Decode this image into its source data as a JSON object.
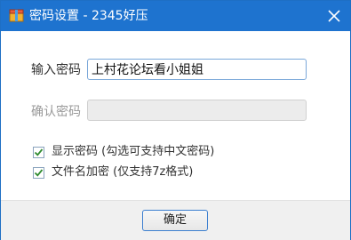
{
  "window": {
    "title": "密码设置 - 2345好压",
    "app_icon": "archive-app-icon",
    "close_icon": "close-icon"
  },
  "form": {
    "password_label": "输入密码",
    "password_value": "上村花论坛看小姐姐",
    "confirm_label": "确认密码",
    "confirm_value": ""
  },
  "options": [
    {
      "label": "显示密码 (勾选可支持中文密码)",
      "checked": true
    },
    {
      "label": "文件名加密 (仅支持7z格式)",
      "checked": true
    }
  ],
  "footer": {
    "ok_label": "确定"
  },
  "colors": {
    "titlebar": "#1e73cf",
    "footer_bg": "#f0f0f0",
    "check_green": "#2f8a2f"
  }
}
